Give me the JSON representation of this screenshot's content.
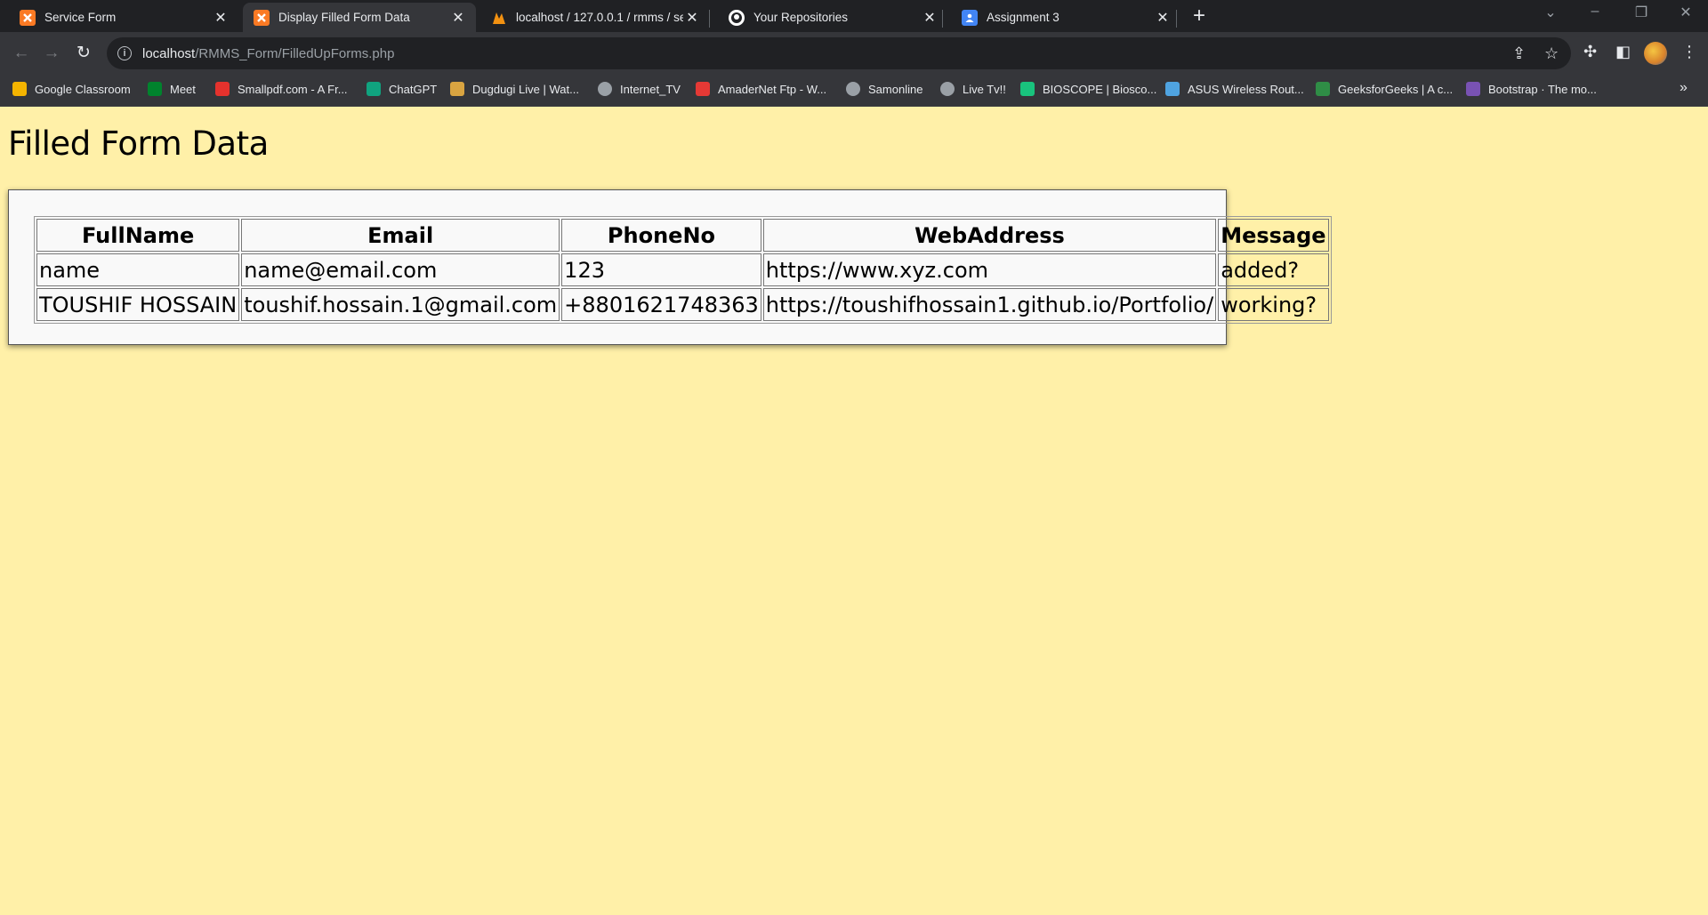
{
  "browser": {
    "tabs": [
      {
        "title": "Service Form",
        "favicon": "xampp-icon",
        "active": false
      },
      {
        "title": "Display Filled Form Data",
        "favicon": "xampp-icon",
        "active": true
      },
      {
        "title": "localhost / 127.0.0.1 / rmms / se",
        "favicon": "phpmyadmin-icon",
        "active": false
      },
      {
        "title": "Your Repositories",
        "favicon": "github-icon",
        "active": false
      },
      {
        "title": "Assignment 3",
        "favicon": "classroom-assignment-icon",
        "active": false
      }
    ],
    "url_host": "localhost",
    "url_path": "/RMMS_Form/FilledUpForms.php",
    "bookmarks": [
      {
        "label": "Google Classroom",
        "icon": "classroom-icon",
        "color": "#f4b400"
      },
      {
        "label": "Meet",
        "icon": "meet-icon",
        "color": "#00832d"
      },
      {
        "label": "Smallpdf.com - A Fr...",
        "icon": "smallpdf-icon",
        "color": "#e5322d"
      },
      {
        "label": "ChatGPT",
        "icon": "chatgpt-icon",
        "color": "#10a37f"
      },
      {
        "label": "Dugdugi Live | Wat...",
        "icon": "dugdugi-icon",
        "color": "#d9a441"
      },
      {
        "label": "Internet_TV",
        "icon": "globe-icon",
        "color": "#9aa0a6"
      },
      {
        "label": "AmaderNet Ftp - W...",
        "icon": "amadernet-icon",
        "color": "#e53935"
      },
      {
        "label": "Samonline",
        "icon": "globe-icon",
        "color": "#9aa0a6"
      },
      {
        "label": "Live Tv!!",
        "icon": "globe-icon",
        "color": "#9aa0a6"
      },
      {
        "label": "BIOSCOPE | Biosco...",
        "icon": "bioscope-icon",
        "color": "#19c37d"
      },
      {
        "label": "ASUS Wireless Rout...",
        "icon": "router-icon",
        "color": "#4fa3e0"
      },
      {
        "label": "GeeksforGeeks | A c...",
        "icon": "geeksforgeeks-icon",
        "color": "#2f8d46"
      },
      {
        "label": "Bootstrap · The mo...",
        "icon": "bootstrap-icon",
        "color": "#7952b3"
      }
    ]
  },
  "page": {
    "title": "Filled Form Data",
    "table": {
      "headers": [
        "FullName",
        "Email",
        "PhoneNo",
        "WebAddress",
        "Message"
      ],
      "rows": [
        [
          "name",
          "name@email.com",
          "123",
          "https://www.xyz.com",
          "added?"
        ],
        [
          "TOUSHIF HOSSAIN",
          "toushif.hossain.1@gmail.com",
          "+8801621748363",
          "https://toushifhossain1.github.io/Portfolio/",
          "working?"
        ]
      ]
    }
  },
  "colors": {
    "page_background": "#fff0a8",
    "card_background": "#f9f9f9",
    "chrome_dark": "#202124",
    "chrome_toolbar": "#35363a"
  }
}
